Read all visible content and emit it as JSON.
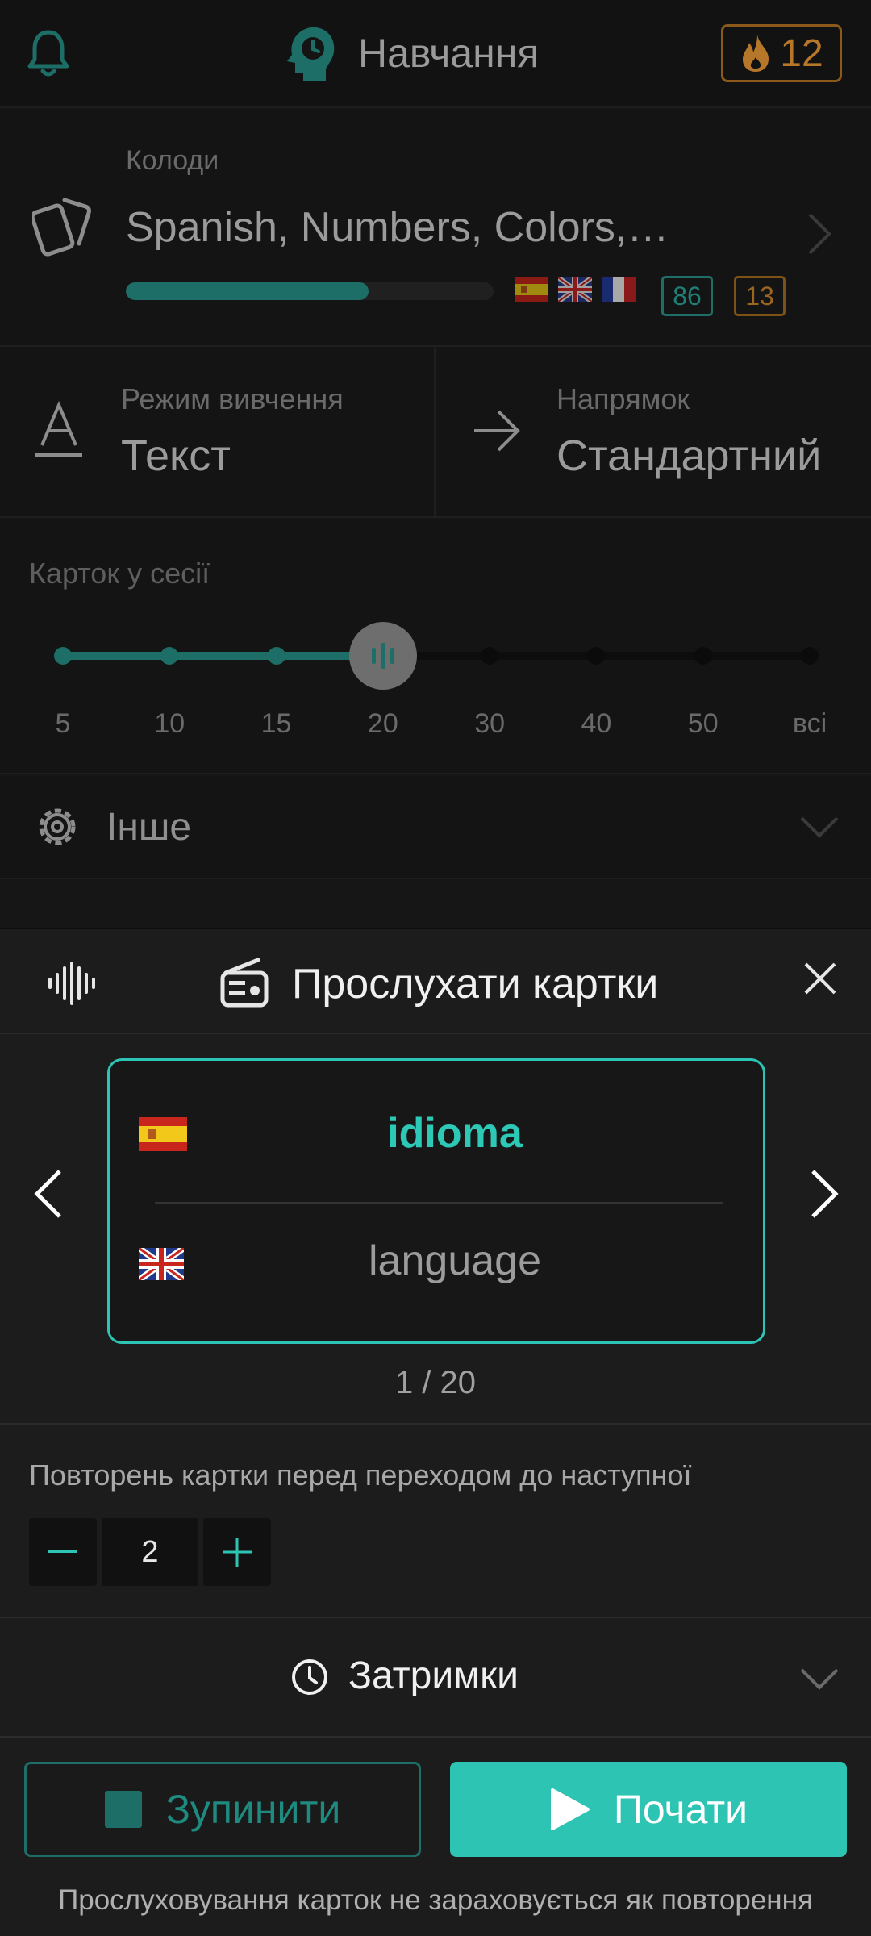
{
  "header": {
    "title": "Навчання",
    "streak": "12"
  },
  "decks": {
    "label": "Колоди",
    "name": "Spanish, Numbers, Colors,…",
    "progress": 0.66,
    "flags": [
      "es-flag",
      "gb-flag",
      "fr-flag"
    ],
    "badge_teal": "86",
    "badge_orange": "13"
  },
  "mode": {
    "label": "Режим вивчення",
    "value": "Текст"
  },
  "direction": {
    "label": "Напрямок",
    "value": "Стандартний"
  },
  "session": {
    "label": "Карток у сесії",
    "ticks": [
      "5",
      "10",
      "15",
      "20",
      "30",
      "40",
      "50",
      "всі"
    ],
    "selected_index": 3
  },
  "other": {
    "label": "Інше"
  },
  "sheet": {
    "title": "Прослухати картки",
    "card": {
      "front": "idioma",
      "back": "language",
      "front_flag": "es-flag",
      "back_flag": "gb-flag"
    },
    "counter": "1 / 20",
    "repeat_label": "Повторень картки перед переходом до наступної",
    "repeat_value": "2",
    "delays_label": "Затримки",
    "stop_label": "Зупинити",
    "start_label": "Почати",
    "footnote": "Прослуховування карток не зараховується як повторення"
  },
  "colors": {
    "accent": "#2ec4b4",
    "accent_dim": "#1d6e66",
    "streak": "#b7772a"
  }
}
